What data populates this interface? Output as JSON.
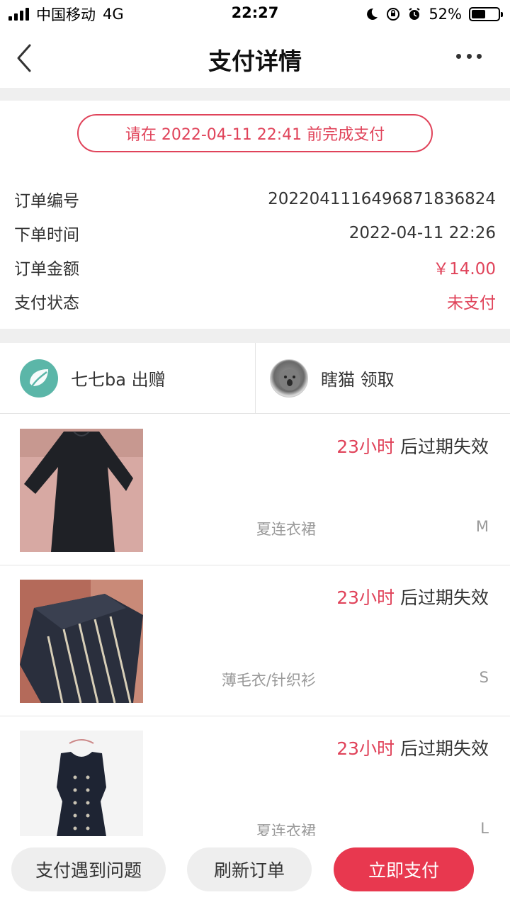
{
  "status_bar": {
    "carrier": "中国移动",
    "network": "4G",
    "time": "22:27",
    "battery": "52%",
    "battery_level": 0.52
  },
  "nav": {
    "title": "支付详情"
  },
  "deadline": "请在 2022-04-11 22:41 前完成支付",
  "order": {
    "rows": [
      {
        "label": "订单编号",
        "value": "20220411164968718368​24"
      },
      {
        "label": "下单时间",
        "value": "2022-04-11 22:26"
      },
      {
        "label": "订单金额",
        "value": "￥14.00"
      },
      {
        "label": "支付状态",
        "value": "未支付"
      }
    ]
  },
  "parties": {
    "giver": "七七ba 出赠",
    "receiver": "瞎猫 领取"
  },
  "items": [
    {
      "hours": "23小时",
      "suffix": " 后过期失效",
      "category": "夏连衣裙",
      "size": "M"
    },
    {
      "hours": "23小时",
      "suffix": " 后过期失效",
      "category": "薄毛衣/针织衫",
      "size": "S"
    },
    {
      "hours": "23小时",
      "suffix": " 后过期失效",
      "category": "夏连衣裙",
      "size": "L"
    }
  ],
  "actions": {
    "problem": "支付遇到问题",
    "refresh": "刷新订单",
    "pay": "立即支付"
  },
  "colors": {
    "accent": "#e0435a",
    "pay_button": "#e8384f"
  }
}
